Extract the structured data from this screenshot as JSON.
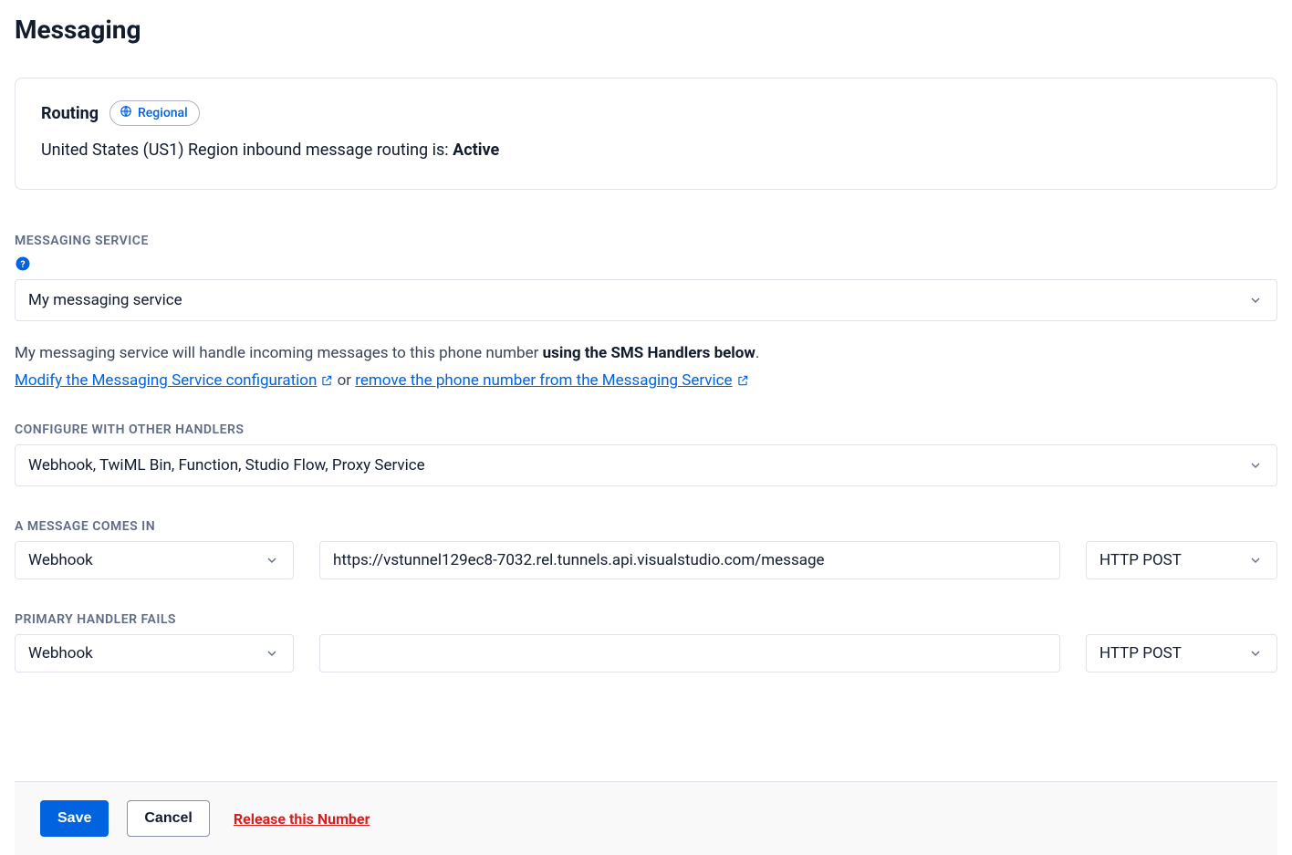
{
  "page": {
    "title": "Messaging"
  },
  "routing": {
    "heading": "Routing",
    "badge": "Regional",
    "status_prefix": "United States (US1) Region inbound message routing is: ",
    "status_value": "Active"
  },
  "messaging_service": {
    "label": "MESSAGING SERVICE",
    "selected": "My messaging service",
    "description_prefix": "My messaging service will handle incoming messages to this phone number ",
    "description_bold": "using the SMS Handlers below",
    "description_suffix": ".",
    "modify_link": "Modify the Messaging Service configuration",
    "or_text": "  or  ",
    "remove_link": "remove the phone number from the Messaging Service"
  },
  "other_handlers": {
    "label": "CONFIGURE WITH OTHER HANDLERS",
    "selected": "Webhook, TwiML Bin, Function, Studio Flow, Proxy Service"
  },
  "message_in": {
    "label": "A MESSAGE COMES IN",
    "type": "Webhook",
    "url": "https://vstunnel129ec8-7032.rel.tunnels.api.visualstudio.com/message",
    "method": "HTTP POST"
  },
  "primary_fail": {
    "label": "PRIMARY HANDLER FAILS",
    "type": "Webhook",
    "url": "",
    "method": "HTTP POST"
  },
  "footer": {
    "save": "Save",
    "cancel": "Cancel",
    "release": "Release this Number"
  }
}
